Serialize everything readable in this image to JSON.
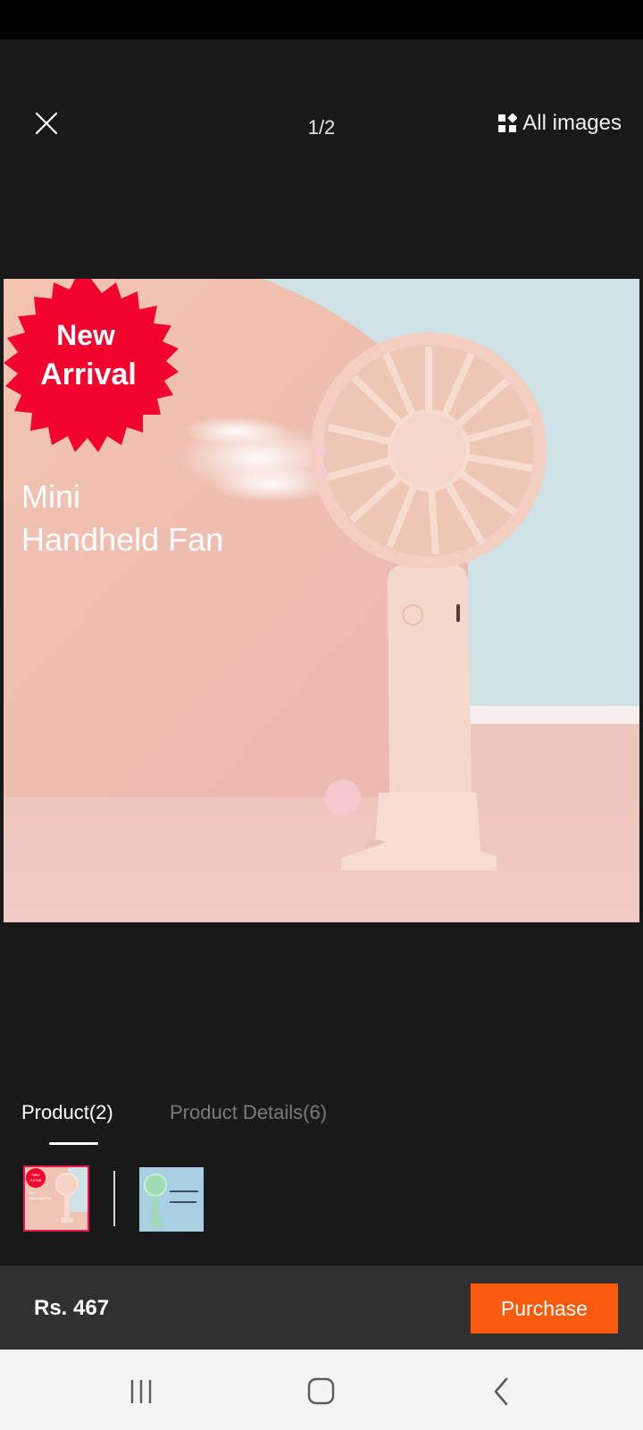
{
  "header": {
    "close_icon": "close-icon",
    "counter": "1/2",
    "all_images_label": "All images",
    "all_images_icon": "grid-icon"
  },
  "main_image": {
    "badge_line1": "New",
    "badge_line2": "Arrival",
    "caption_line1": "Mini",
    "caption_line2": "Handheld Fan"
  },
  "tabs": [
    {
      "label": "Product(2)",
      "active": true
    },
    {
      "label": "Product Details(6)",
      "active": false
    }
  ],
  "thumbnails": {
    "selected_index": 0,
    "badge_line1": "New",
    "badge_line2": "Arrival",
    "caption_line1": "Mini",
    "caption_line2": "Handheld Fan"
  },
  "bottom_bar": {
    "price": "Rs. 467",
    "purchase_label": "Purchase"
  },
  "nav": {
    "recents_icon": "recents-icon",
    "home_icon": "home-icon",
    "back_icon": "back-icon"
  },
  "colors": {
    "accent": "#f95a0e",
    "badge": "#f2042c",
    "selected_border": "#e8174e",
    "background": "#191919"
  }
}
